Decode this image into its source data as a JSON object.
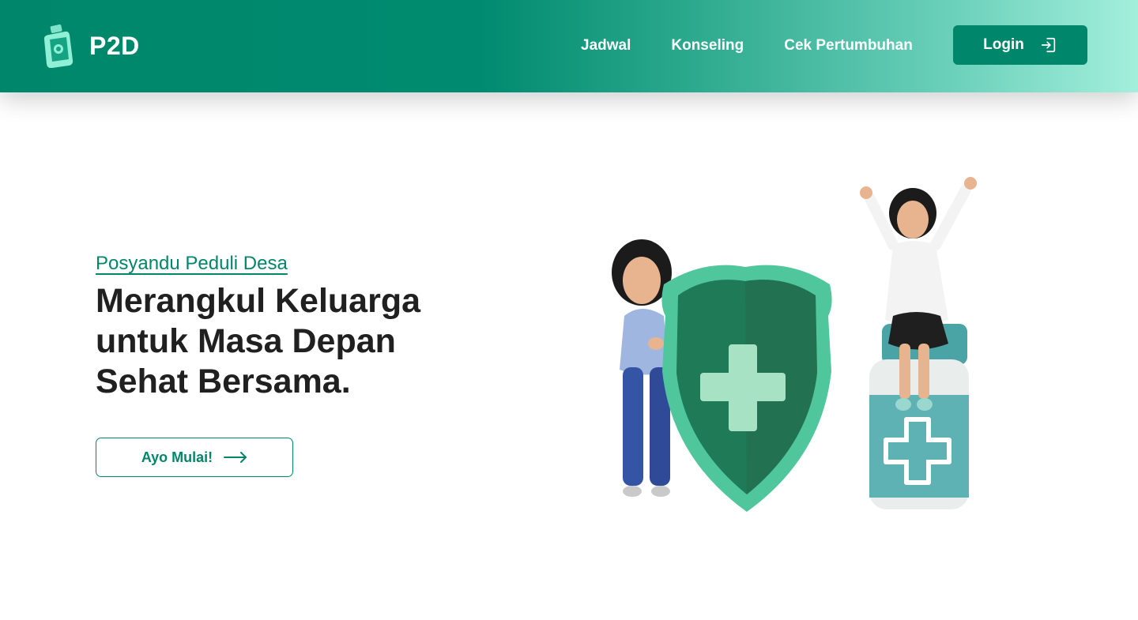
{
  "brand": {
    "name": "P2D",
    "icon": "medicine-bottle-icon"
  },
  "nav": {
    "links": [
      {
        "label": "Jadwal"
      },
      {
        "label": "Konseling"
      },
      {
        "label": "Cek Pertumbuhan"
      }
    ],
    "login": {
      "label": "Login",
      "icon": "login-icon"
    }
  },
  "hero": {
    "eyebrow": "Posyandu Peduli Desa",
    "headline": "Merangkul Keluarga untuk Masa Depan Sehat Bersama.",
    "cta": {
      "label": "Ayo Mulai!",
      "icon": "arrow-right-icon"
    },
    "illustration": "health-shield-illustration"
  },
  "colors": {
    "primary": "#00876b",
    "gradient_end": "#a3efdc",
    "text_dark": "#202020",
    "white": "#ffffff"
  }
}
